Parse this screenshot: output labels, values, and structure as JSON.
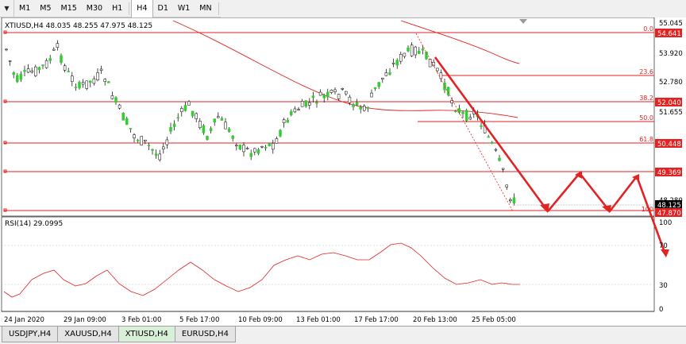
{
  "toolbar": {
    "dropdown_icon": "triangle-down-icon",
    "timeframes": [
      "M1",
      "M5",
      "M15",
      "M30",
      "H1",
      "H4",
      "D1",
      "W1",
      "MN"
    ],
    "active_timeframe": "H4"
  },
  "chart": {
    "header": "XTIUSD,H4  48.035 48.255 47.975 48.125",
    "price_axis_labels": [
      "55.045",
      "53.920",
      "52.780",
      "51.655",
      "48.280"
    ],
    "badges": [
      {
        "text": "54.641",
        "color": "#e32222"
      },
      {
        "text": "52.040",
        "color": "#e32222"
      },
      {
        "text": "50.448",
        "color": "#e32222"
      },
      {
        "text": "49.369",
        "color": "#e32222"
      },
      {
        "text": "48.125",
        "color": "#000000"
      },
      {
        "text": "47.870",
        "color": "#e32222"
      }
    ],
    "fib_labels": [
      "0.0",
      "23.6",
      "38.2",
      "50.0",
      "61.8",
      "100"
    ],
    "time_labels": [
      "24 Jan 2020",
      "29 Jan 09:00",
      "3 Feb 01:00",
      "5 Feb 17:00",
      "10 Feb 09:00",
      "13 Feb 01:00",
      "17 Feb 17:00",
      "20 Feb 13:00",
      "25 Feb 05:00"
    ],
    "up_color": "#32cd32",
    "down_color": "#000000",
    "line_color": "#e32222"
  },
  "rsi": {
    "label": "RSI(14) 29.0995",
    "levels": [
      "100",
      "70",
      "30",
      "0"
    ],
    "line_color": "#e32222"
  },
  "tabs": [
    "USDJPY,H4",
    "XAUUSD,H4",
    "XTIUSD,H4",
    "EURUSD,H4"
  ],
  "active_tab": "XTIUSD,H4"
}
